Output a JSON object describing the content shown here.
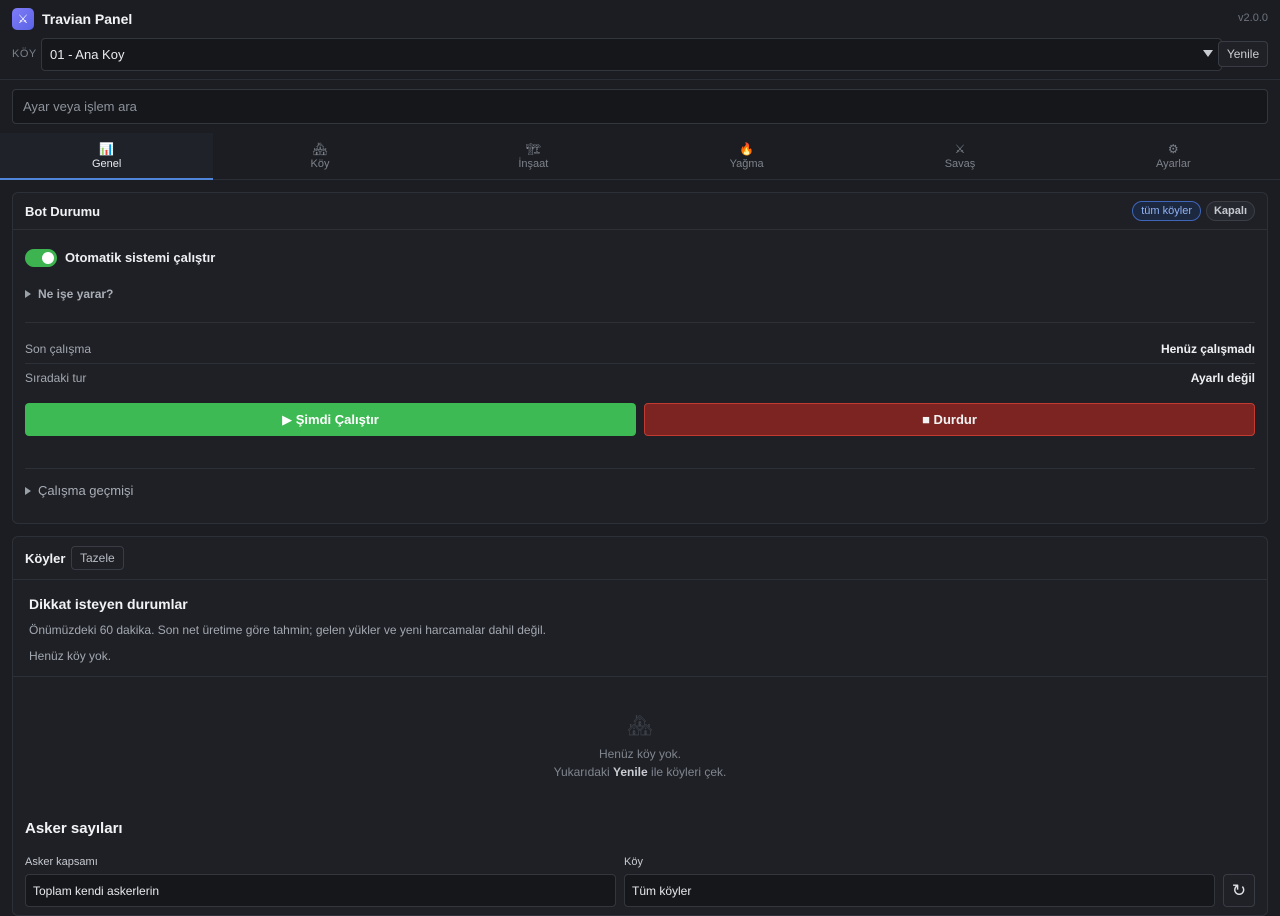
{
  "header": {
    "title": "Travian Panel",
    "logo_glyph": "⚔",
    "version": "v2.0.0"
  },
  "village_bar": {
    "label": "KÖY",
    "selected": "01 - Ana Koy",
    "refresh_label": "Yenile"
  },
  "search": {
    "placeholder": "Ayar veya işlem ara"
  },
  "tabs": [
    {
      "icon": "📊",
      "label": "Genel",
      "active": true
    },
    {
      "icon": "🏘",
      "label": "Köy"
    },
    {
      "icon": "🏗",
      "label": "İnşaat"
    },
    {
      "icon": "🔥",
      "label": "Yağma"
    },
    {
      "icon": "⚔",
      "label": "Savaş"
    },
    {
      "icon": "⚙",
      "label": "Ayarlar"
    }
  ],
  "bot_status": {
    "title": "Bot Durumu",
    "badge_scope": "tüm köyler",
    "badge_state": "Kapalı",
    "toggle_label": "Otomatik sistemi çalıştır",
    "toggle_on": true,
    "help_label": "Ne işe yarar?",
    "rows": [
      {
        "key": "Son çalışma",
        "value": "Henüz çalışmadı"
      },
      {
        "key": "Sıradaki tur",
        "value": "Ayarlı değil"
      }
    ],
    "run_label": "▶ Şimdi Çalıştır",
    "stop_label": "■ Durdur",
    "history_label": "Çalışma geçmişi",
    "colors": {
      "run": "#3dba53",
      "stop": "#7b2421"
    }
  },
  "villages": {
    "title": "Köyler",
    "refresh_label": "Tazele",
    "attention_title": "Dikkat isteyen durumlar",
    "attention_subtitle": "Önümüzdeki 60 dakika. Son net üretime göre tahmin; gelen yükler ve yeni harcamalar dahil değil.",
    "attention_empty": "Henüz köy yok.",
    "empty_icon": "🏘",
    "empty_line1": "Henüz köy yok.",
    "empty_line2_prefix": "Yukarıdaki",
    "empty_line2_bold": "Yenile",
    "empty_line2_suffix": "ile köyleri çek.",
    "troops_title": "Asker sayıları",
    "scope_label": "Asker kapsamı",
    "scope_value": "Toplam kendi askerlerin",
    "village_label": "Köy",
    "village_value": "Tüm köyler",
    "reload_glyph": "↻"
  }
}
